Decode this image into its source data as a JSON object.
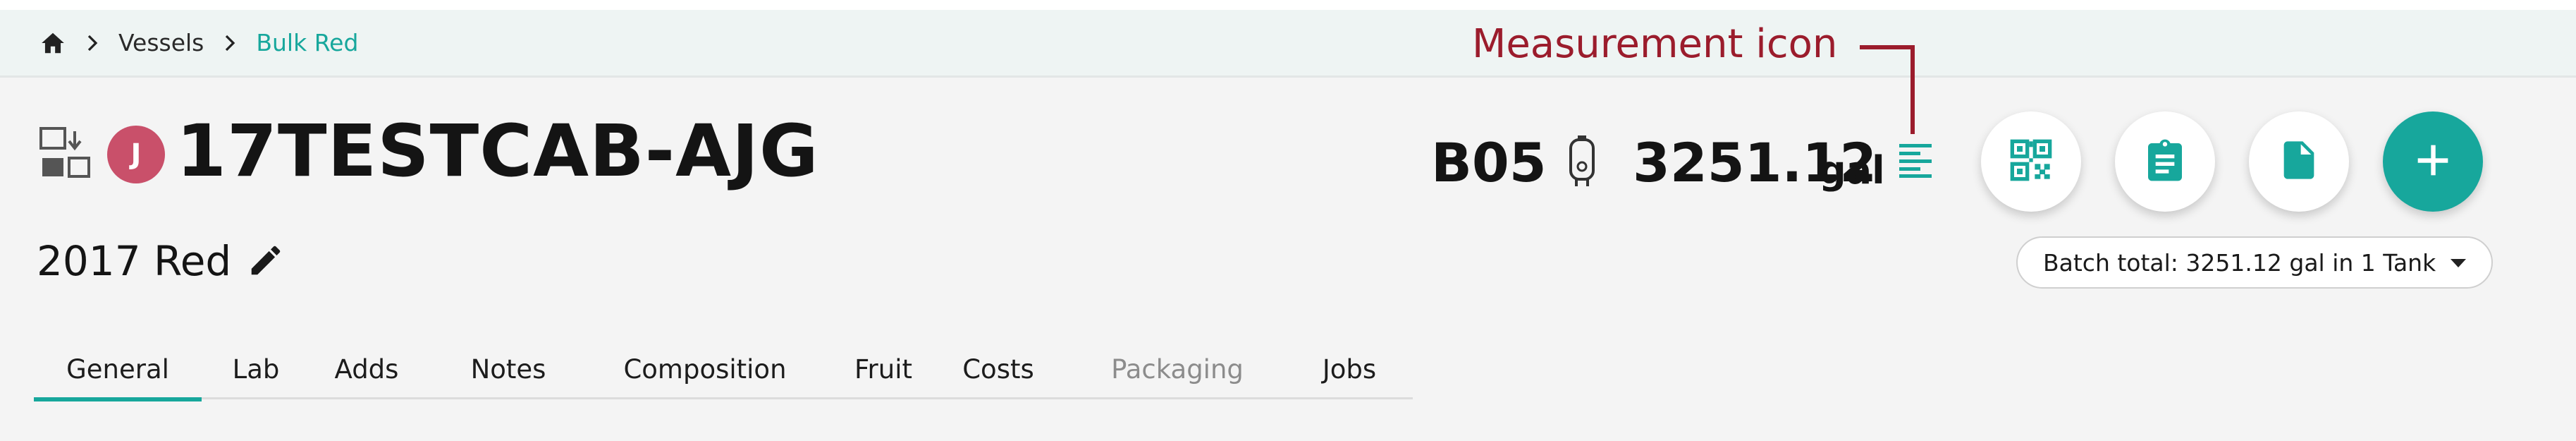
{
  "annotation": {
    "label": "Measurement icon"
  },
  "breadcrumb": {
    "home_icon": "home-icon",
    "items": [
      "Vessels",
      "Bulk Red"
    ]
  },
  "header": {
    "avatar_initial": "J",
    "batch_name": "17TESTCAB-AJG",
    "subtitle": "2017 Red",
    "vessel_code": "B05",
    "volume_value": "3251.12",
    "volume_unit": "gal"
  },
  "actions": {
    "qr": "qr-code-icon",
    "clipboard": "clipboard-icon",
    "document": "document-icon",
    "add": "plus-icon"
  },
  "batch_total": {
    "label": "Batch total: 3251.12 gal in 1 Tank"
  },
  "tabs": [
    {
      "label": "General",
      "active": true
    },
    {
      "label": "Lab"
    },
    {
      "label": "Adds"
    },
    {
      "label": "Notes"
    },
    {
      "label": "Composition"
    },
    {
      "label": "Fruit"
    },
    {
      "label": "Costs"
    },
    {
      "label": "Packaging",
      "disabled": true
    },
    {
      "label": "Jobs"
    }
  ],
  "colors": {
    "accent": "#17a79c",
    "annotation": "#9b1c2c",
    "avatar": "#c9506a"
  }
}
